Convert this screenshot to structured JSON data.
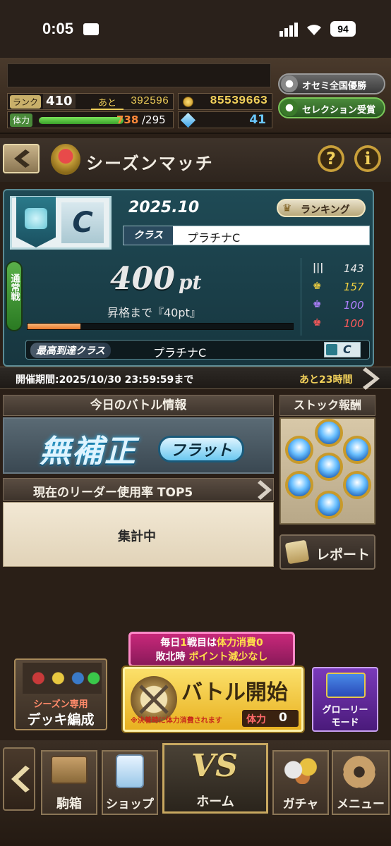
{
  "status_bar": {
    "time": "0:05",
    "battery": "94"
  },
  "header": {
    "rank_label": "ランク",
    "rank_value": "410",
    "next_label": "あと",
    "next_value": "392596",
    "stamina_label": "体力",
    "stamina_current": "738",
    "stamina_max": "/295",
    "stamina_fill_pct": 100,
    "coins": "85539663",
    "gems": "41",
    "btn_national": "オセミ全国優勝",
    "btn_selection": "セレクション受賞"
  },
  "title_bar": {
    "title": "シーズンマッチ"
  },
  "season": {
    "date": "2025.10",
    "ranking_label": "ランキング",
    "class_label": "クラス",
    "class_value": "プラチナC",
    "class_letter": "C",
    "mode_label": "通常戦",
    "points": "400",
    "points_unit": "pt",
    "promo_text": "昇格まで『40pt』",
    "progress_pct": 20,
    "stats": [
      {
        "icon": "bars-icon",
        "value": "143",
        "color": "#e8e8e8"
      },
      {
        "icon": "gold-crown-icon",
        "value": "157",
        "color": "#f0d040"
      },
      {
        "icon": "purple-crown-icon",
        "value": "100",
        "color": "#b080ff"
      },
      {
        "icon": "red-crown-icon",
        "value": "100",
        "color": "#ff5a5a"
      }
    ],
    "best_label": "最高到達クラス",
    "best_value": "プラチナC",
    "best_letter": "C",
    "period": "開催期間:2025/10/30 23:59:59まで",
    "remaining": "あと23時間"
  },
  "battle_info": {
    "header": "今日のバトル情報",
    "banner_main": "無補正",
    "banner_sub": "フラット",
    "leader_header": "現在のリーダー使用率 TOP5",
    "aggregating": "集計中"
  },
  "stock": {
    "header": "ストック報酬",
    "report_label": "レポート"
  },
  "promo": {
    "line1_a": "毎日",
    "line1_b": "1",
    "line1_c": "戦目は",
    "line1_d": "体力消費0",
    "line2_a": "敗北時",
    "line2_b": "ポイント減少なし"
  },
  "actions": {
    "deck_line1": "シーズン専用",
    "deck_line2": "デッキ編成",
    "battle_label": "バトル開始",
    "battle_note": "※決着時に体力消費されます",
    "battle_cost_label": "体力",
    "battle_cost_value": "0",
    "glory_line1": "グローリー",
    "glory_line2": "モード"
  },
  "bottom_nav": [
    {
      "label": "駒箱"
    },
    {
      "label": "ショップ"
    },
    {
      "label": "ホーム"
    },
    {
      "label": "ガチャ"
    },
    {
      "label": "メニュー"
    }
  ],
  "colors": {
    "accent_gold": "#f0cf5a",
    "teal_panel": "#1f4a55",
    "battle_yellow": "#f2c531",
    "glory_purple": "#5a2a8a"
  }
}
